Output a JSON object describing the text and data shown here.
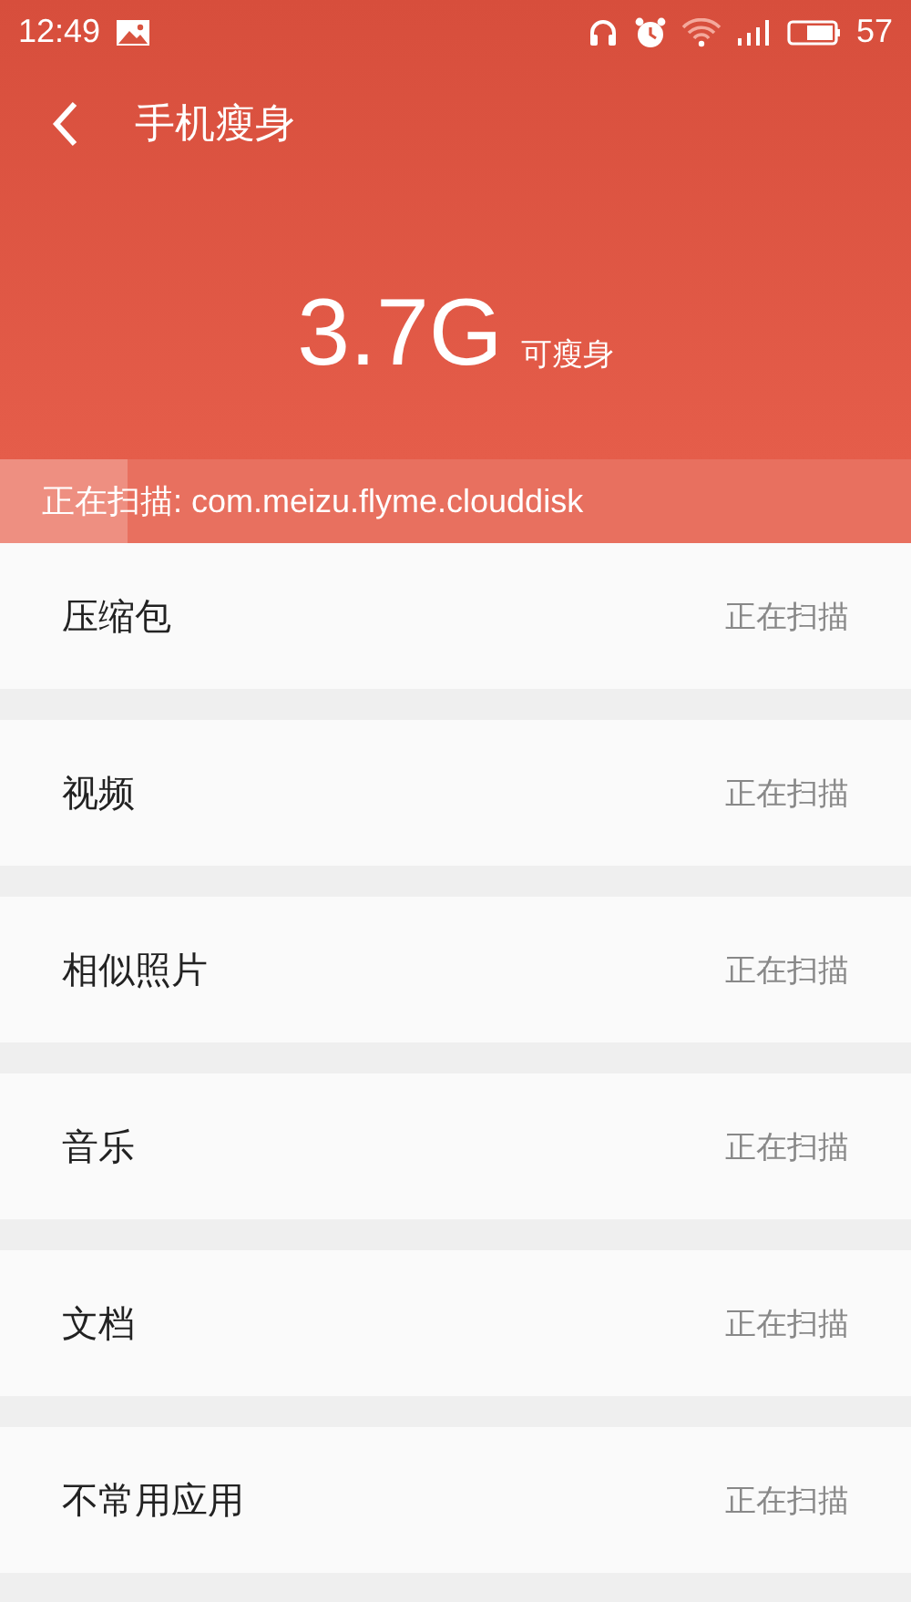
{
  "status_bar": {
    "time": "12:49",
    "battery": "57"
  },
  "header": {
    "title": "手机瘦身"
  },
  "summary": {
    "size": "3.7G",
    "caption": "可瘦身"
  },
  "scan": {
    "text": "正在扫描: com.meizu.flyme.clouddisk",
    "level": 0.14
  },
  "categories": [
    {
      "name": "压缩包",
      "status": "正在扫描"
    },
    {
      "name": "视频",
      "status": "正在扫描"
    },
    {
      "name": "相似照片",
      "status": "正在扫描"
    },
    {
      "name": "音乐",
      "status": "正在扫描"
    },
    {
      "name": "文档",
      "status": "正在扫描"
    },
    {
      "name": "不常用应用",
      "status": "正在扫描"
    }
  ]
}
